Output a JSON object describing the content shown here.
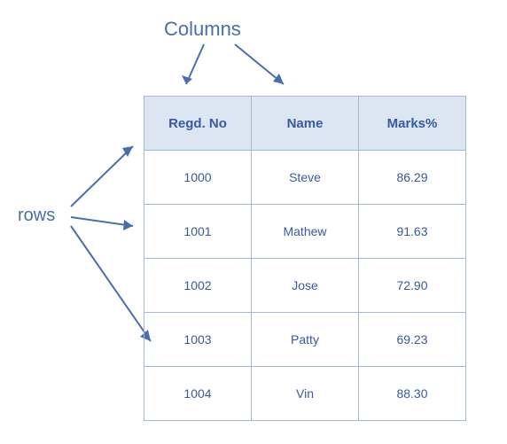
{
  "labels": {
    "columns": "Columns",
    "rows": "rows"
  },
  "chart_data": {
    "type": "table",
    "title": "",
    "columns": [
      "Regd. No",
      "Name",
      "Marks%"
    ],
    "rows": [
      [
        "1000",
        "Steve",
        "86.29"
      ],
      [
        "1001",
        "Mathew",
        "91.63"
      ],
      [
        "1002",
        "Jose",
        "72.90"
      ],
      [
        "1003",
        "Patty",
        "69.23"
      ],
      [
        "1004",
        "Vin",
        "88.30"
      ]
    ]
  }
}
